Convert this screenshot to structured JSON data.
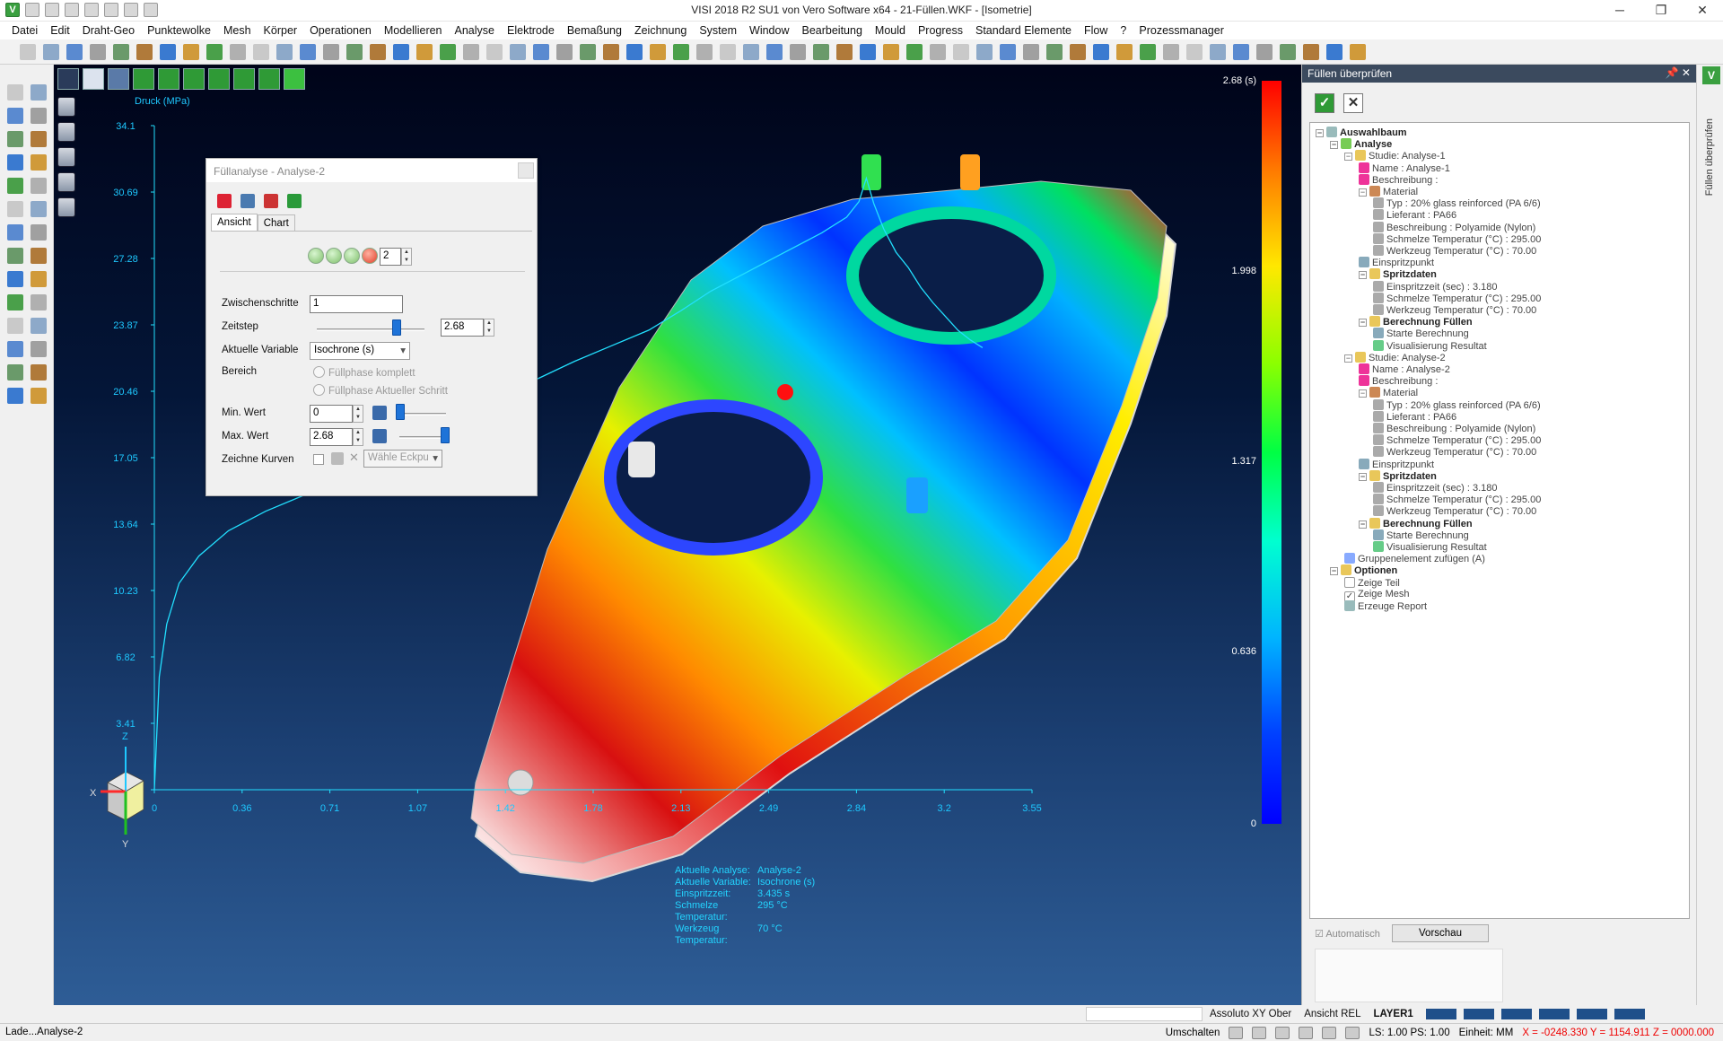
{
  "window": {
    "title": "VISI 2018 R2 SU1 von Vero Software x64 - 21-Füllen.WKF - [Isometrie]",
    "minimize": "─",
    "restore": "❐",
    "close": "✕",
    "logo_letter": "V"
  },
  "menu": [
    "Datei",
    "Edit",
    "Draht-Geo",
    "Punktewolke",
    "Mesh",
    "Körper",
    "Operationen",
    "Modellieren",
    "Analyse",
    "Elektrode",
    "Bemaßung",
    "Zeichnung",
    "System",
    "Window",
    "Bearbeitung",
    "Mould",
    "Progress",
    "Standard Elemente",
    "Flow",
    "?",
    "Prozessmanager"
  ],
  "chart_data": {
    "type": "line",
    "title": "",
    "ylabel": "Druck (MPa)",
    "xlabel": "",
    "y_ticks": [
      "0",
      "3.41",
      "6.82",
      "10.23",
      "13.64",
      "17.05",
      "20.46",
      "23.87",
      "27.28",
      "30.69",
      "34.1"
    ],
    "x_ticks": [
      "0",
      "0.36",
      "0.71",
      "1.07",
      "1.42",
      "1.78",
      "2.13",
      "2.49",
      "2.84",
      "3.2",
      "3.55"
    ],
    "xlim": [
      0,
      3.55
    ],
    "ylim": [
      0,
      34.1
    ],
    "series": [
      {
        "color": "#22e0ff",
        "x": [
          0.0,
          0.02,
          0.05,
          0.1,
          0.18,
          0.3,
          0.45,
          0.62,
          0.8,
          1.0,
          1.15,
          1.3,
          1.42,
          1.55,
          1.7,
          1.85,
          2.0,
          2.13,
          2.25,
          2.4,
          2.55,
          2.7,
          2.8,
          2.85,
          2.88,
          2.91,
          2.95,
          3.0,
          3.05,
          3.1,
          3.15,
          3.2,
          3.25,
          3.3,
          3.35
        ],
        "y": [
          0.0,
          5.8,
          8.5,
          10.6,
          12.0,
          13.3,
          14.3,
          15.2,
          16.3,
          17.4,
          18.2,
          19.2,
          20.2,
          21.1,
          22.0,
          22.8,
          23.6,
          24.6,
          25.6,
          26.6,
          27.6,
          28.6,
          29.4,
          30.2,
          31.4,
          30.1,
          28.8,
          27.6,
          26.8,
          25.8,
          25.0,
          24.3,
          23.6,
          23.1,
          22.7
        ]
      }
    ],
    "grid": false,
    "legend": "none"
  },
  "color_scale": {
    "labels": [
      "2.68 (s)",
      "1.998",
      "1.317",
      "0.636",
      "0"
    ]
  },
  "analysis_info": [
    {
      "key": "Aktuelle Analyse:",
      "value": "Analyse-2"
    },
    {
      "key": "Aktuelle Variable:",
      "value": "Isochrone (s)"
    },
    {
      "key": "Einspritzzeit:",
      "value": "3.435 s"
    },
    {
      "key": "Schmelze Temperatur:",
      "value": "295 °C"
    },
    {
      "key": "Werkzeug Temperatur:",
      "value": "70 °C"
    }
  ],
  "dialog": {
    "title": "Füllanalyse - Analyse-2",
    "tabs": [
      "Ansicht",
      "Chart"
    ],
    "step_value": "2",
    "zwischenschritte_label": "Zwischenschritte",
    "zwischenschritte_value": "1",
    "zeitstep_label": "Zeitstep",
    "zeitstep_value": "2.68",
    "variable_label": "Aktuelle Variable",
    "variable_value": "Isochrone (s)",
    "bereich_label": "Bereich",
    "bereich_opt1": "Füllphase komplett",
    "bereich_opt2": "Füllphase Aktueller Schritt",
    "min_label": "Min. Wert",
    "min_value": "0",
    "max_label": "Max. Wert",
    "max_value": "2.68",
    "kurven_label": "Zeichne Kurven",
    "kurven_select": "Wähle Eckpu"
  },
  "right_panel": {
    "title": "Füllen überprüfen",
    "side_label": "Füllen überprüfen",
    "tree": [
      {
        "t": "Auswahlbaum",
        "l": 0,
        "bold": true,
        "tog": "−",
        "ic": "#9bb"
      },
      {
        "t": "Analyse",
        "l": 1,
        "bold": true,
        "tog": "−",
        "ic": "#7c5"
      },
      {
        "t": "Studie: Analyse-1",
        "l": 2,
        "tog": "−",
        "ic": "#e9c75a"
      },
      {
        "t": "Name : Analyse-1",
        "l": 3,
        "ic": "#e39"
      },
      {
        "t": "Beschreibung :",
        "l": 3,
        "ic": "#e39"
      },
      {
        "t": "Material",
        "l": 3,
        "tog": "−",
        "ic": "#c85"
      },
      {
        "t": "Typ : 20% glass reinforced (PA 6/6)",
        "l": 4,
        "ic": "#aaa"
      },
      {
        "t": "Lieferant : PA66",
        "l": 4,
        "ic": "#aaa"
      },
      {
        "t": "Beschreibung : Polyamide (Nylon)",
        "l": 4,
        "ic": "#aaa"
      },
      {
        "t": "Schmelze Temperatur (°C) : 295.00",
        "l": 4,
        "ic": "#aaa"
      },
      {
        "t": "Werkzeug Temperatur (°C) : 70.00",
        "l": 4,
        "ic": "#aaa"
      },
      {
        "t": "Einspritzpunkt",
        "l": 3,
        "ic": "#8ab"
      },
      {
        "t": "Spritzdaten",
        "l": 3,
        "bold": true,
        "tog": "−",
        "ic": "#e9c75a"
      },
      {
        "t": "Einspritzzeit (sec) : 3.180",
        "l": 4,
        "ic": "#aaa"
      },
      {
        "t": "Schmelze Temperatur (°C) : 295.00",
        "l": 4,
        "ic": "#aaa"
      },
      {
        "t": "Werkzeug Temperatur (°C) : 70.00",
        "l": 4,
        "ic": "#aaa"
      },
      {
        "t": "Berechnung Füllen",
        "l": 3,
        "bold": true,
        "tog": "−",
        "ic": "#e9c75a"
      },
      {
        "t": "Starte Berechnung",
        "l": 4,
        "ic": "#8ab"
      },
      {
        "t": "Visualisierung Resultat",
        "l": 4,
        "ic": "#6c8"
      },
      {
        "t": "Studie: Analyse-2",
        "l": 2,
        "tog": "−",
        "ic": "#e9c75a"
      },
      {
        "t": "Name : Analyse-2",
        "l": 3,
        "ic": "#e39"
      },
      {
        "t": "Beschreibung :",
        "l": 3,
        "ic": "#e39"
      },
      {
        "t": "Material",
        "l": 3,
        "tog": "−",
        "ic": "#c85"
      },
      {
        "t": "Typ : 20% glass reinforced (PA 6/6)",
        "l": 4,
        "ic": "#aaa"
      },
      {
        "t": "Lieferant : PA66",
        "l": 4,
        "ic": "#aaa"
      },
      {
        "t": "Beschreibung : Polyamide (Nylon)",
        "l": 4,
        "ic": "#aaa"
      },
      {
        "t": "Schmelze Temperatur (°C) : 295.00",
        "l": 4,
        "ic": "#aaa"
      },
      {
        "t": "Werkzeug Temperatur (°C) : 70.00",
        "l": 4,
        "ic": "#aaa"
      },
      {
        "t": "Einspritzpunkt",
        "l": 3,
        "ic": "#8ab"
      },
      {
        "t": "Spritzdaten",
        "l": 3,
        "bold": true,
        "tog": "−",
        "ic": "#e9c75a"
      },
      {
        "t": "Einspritzzeit (sec) : 3.180",
        "l": 4,
        "ic": "#aaa"
      },
      {
        "t": "Schmelze Temperatur (°C) : 295.00",
        "l": 4,
        "ic": "#aaa"
      },
      {
        "t": "Werkzeug Temperatur (°C) : 70.00",
        "l": 4,
        "ic": "#aaa"
      },
      {
        "t": "Berechnung Füllen",
        "l": 3,
        "bold": true,
        "tog": "−",
        "ic": "#e9c75a"
      },
      {
        "t": "Starte Berechnung",
        "l": 4,
        "ic": "#8ab"
      },
      {
        "t": "Visualisierung Resultat",
        "l": 4,
        "ic": "#6c8"
      },
      {
        "t": "Gruppenelement zufügen (A)",
        "l": 2,
        "ic": "#8af"
      },
      {
        "t": "Optionen",
        "l": 1,
        "bold": true,
        "tog": "−",
        "ic": "#e9c75a"
      },
      {
        "t": "Zeige Teil",
        "l": 2,
        "check": false
      },
      {
        "t": "Zeige Mesh",
        "l": 2,
        "check": true
      },
      {
        "t": "Erzeuge Report",
        "l": 2,
        "ic": "#9bb"
      }
    ],
    "automatisch": "Automatisch",
    "vorschau": "Vorschau"
  },
  "status": {
    "left": "Lade...Analyse-2",
    "assoluto": "Assoluto XY Ober",
    "ansicht": "Ansicht REL",
    "layer": "LAYER1",
    "umschalten": "Umschalten",
    "ls": "LS: 1.00 PS: 1.00",
    "einheit": "Einheit: MM",
    "coords": "X = -0248.330 Y = 1154.911 Z = 0000.000"
  },
  "axis_triad": {
    "x": "X",
    "y": "Y",
    "z": "Z"
  },
  "colors": {
    "viewport_top": "#000419",
    "viewport_bottom": "#2e5d96",
    "curve": "#22e0ff",
    "panel_header": "#3b4a5e"
  }
}
